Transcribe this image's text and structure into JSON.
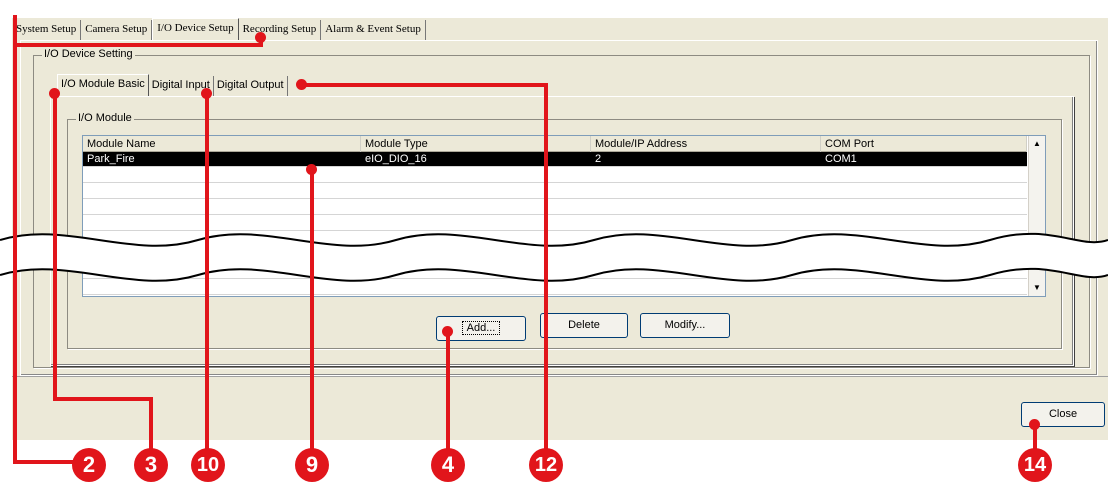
{
  "top_tabs": [
    "System Setup",
    "Camera Setup",
    "I/O Device Setup",
    "Recording Setup",
    "Alarm & Event Setup"
  ],
  "active_top_tab": "I/O Device Setup",
  "io_device_setting_label": "I/O Device Setting",
  "sub_tabs": [
    "I/O Module Basic",
    "Digital Input",
    "Digital Output"
  ],
  "active_sub_tab": "I/O Module Basic",
  "io_module_label": "I/O Module",
  "table": {
    "columns": [
      "Module Name",
      "Module Type",
      "Module/IP Address",
      "COM Port"
    ],
    "rows": [
      [
        "Park_Fire",
        "eIO_DIO_16",
        "2",
        "COM1"
      ]
    ],
    "selected_row": 0
  },
  "buttons": {
    "add": "Add...",
    "delete": "Delete",
    "modify": "Modify...",
    "close": "Close"
  },
  "callouts": [
    "2",
    "3",
    "10",
    "9",
    "4",
    "12",
    "14"
  ],
  "colors": {
    "callout": "#e1151b",
    "window_bg": "#ece9d8",
    "selection_bg": "#000000"
  }
}
